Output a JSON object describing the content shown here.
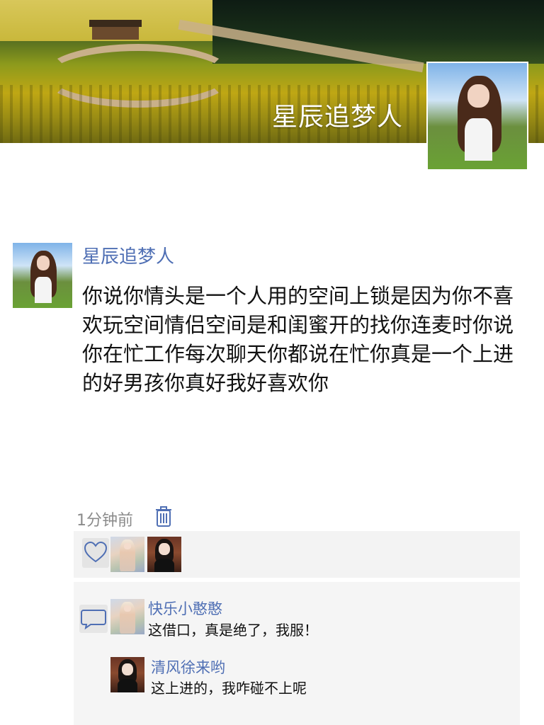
{
  "header": {
    "title": "星辰追梦人"
  },
  "post": {
    "author": "星辰追梦人",
    "text": "你说你情头是一个人用的空间上锁是因为你不喜欢玩空间情侣空间是和闺蜜开的找你连麦时你说你在忙工作每次聊天你都说在忙你真是一个上进的好男孩你真好我好喜欢你",
    "time": "1分钟前"
  },
  "likes": {
    "icon": "heart-icon",
    "count": 2
  },
  "comments": [
    {
      "author": "快乐小憨憨",
      "text": "这借口，真是绝了，我服！"
    },
    {
      "author": "清风徐来哟",
      "text": "这上进的，我咋碰不上呢"
    }
  ],
  "colors": {
    "link": "#4f6fb4",
    "meta": "#8b8b8b",
    "panel": "#f3f3f3"
  }
}
